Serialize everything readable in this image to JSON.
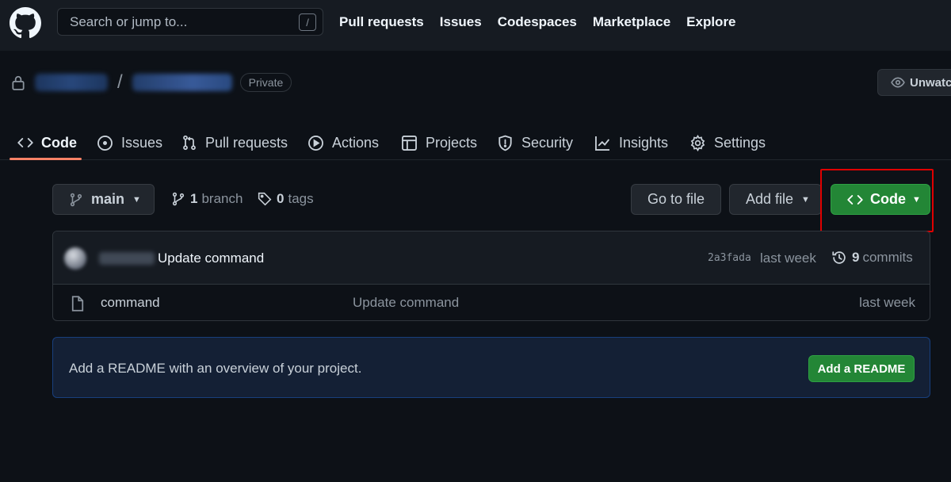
{
  "header": {
    "search_placeholder": "Search or jump to...",
    "search_shortcut": "/",
    "nav": [
      "Pull requests",
      "Issues",
      "Codespaces",
      "Marketplace",
      "Explore"
    ]
  },
  "repo": {
    "separator": "/",
    "visibility": "Private",
    "unwatch_label": "Unwatch"
  },
  "tabs": [
    {
      "label": "Code",
      "icon": "code-icon",
      "active": true
    },
    {
      "label": "Issues",
      "icon": "issue-opened-icon"
    },
    {
      "label": "Pull requests",
      "icon": "git-pull-request-icon"
    },
    {
      "label": "Actions",
      "icon": "play-icon"
    },
    {
      "label": "Projects",
      "icon": "table-icon"
    },
    {
      "label": "Security",
      "icon": "shield-icon"
    },
    {
      "label": "Insights",
      "icon": "graph-icon"
    },
    {
      "label": "Settings",
      "icon": "gear-icon"
    }
  ],
  "toolbar": {
    "branch": "main",
    "branch_count": "1",
    "branch_label": "branch",
    "tag_count": "0",
    "tag_label": "tags",
    "goto_file": "Go to file",
    "add_file": "Add file",
    "code": "Code"
  },
  "latest_commit": {
    "message": "Update command",
    "sha": "2a3fada",
    "time": "last week",
    "commit_count": "9",
    "commit_label": "commits"
  },
  "files": [
    {
      "name": "command",
      "commit_message": "Update command",
      "time": "last week",
      "icon": "file-icon"
    }
  ],
  "readme_banner": {
    "text": "Add a README with an overview of your project.",
    "button": "Add a README"
  },
  "colors": {
    "accent_green": "#238636",
    "active_tab_underline": "#f78166",
    "highlight_box": "#e00000"
  }
}
